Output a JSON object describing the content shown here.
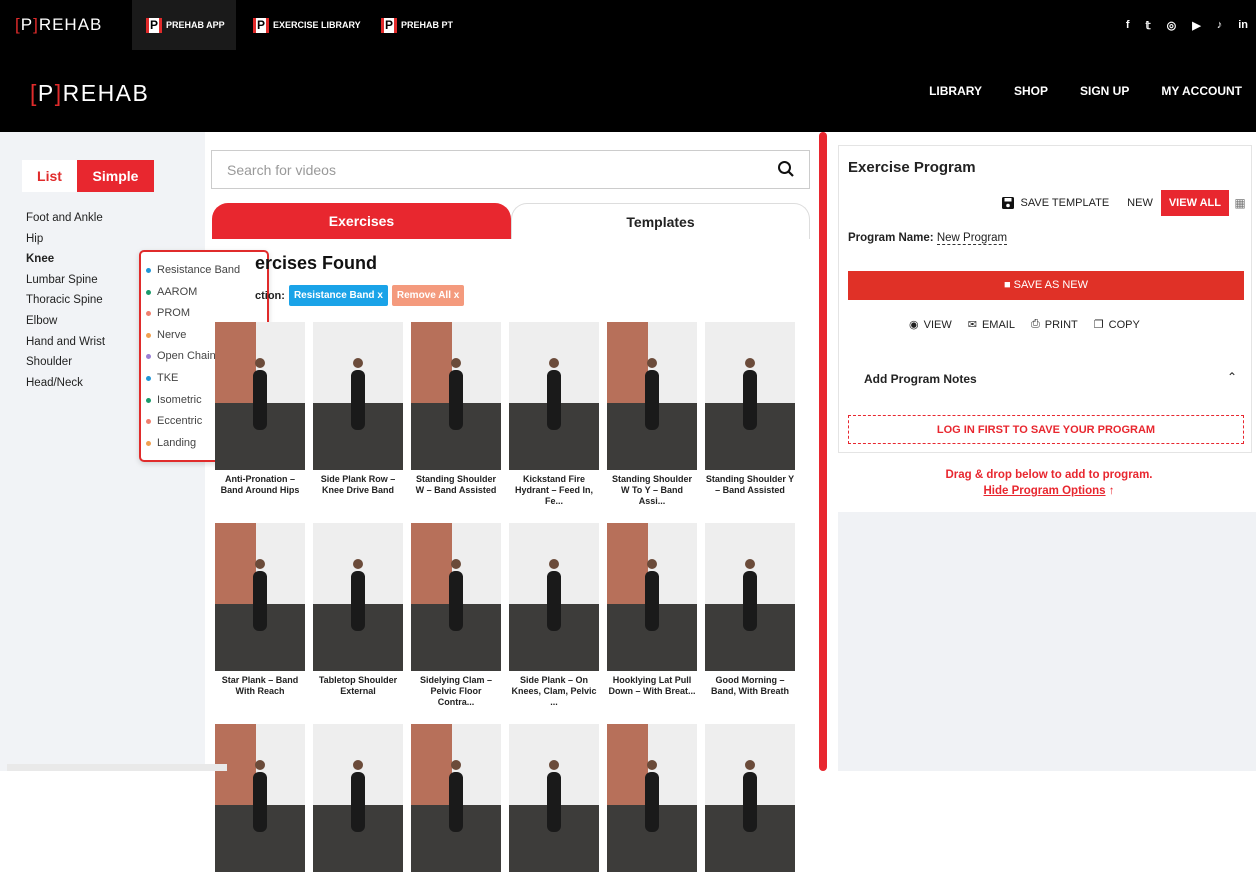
{
  "topbar": {
    "brand": "PREHAB",
    "links": [
      "PREHAB APP",
      "EXERCISE LIBRARY",
      "PREHAB PT"
    ],
    "social_icons": [
      "facebook-icon",
      "twitter-icon",
      "instagram-icon",
      "youtube-icon",
      "tiktok-icon",
      "linkedin-icon"
    ],
    "social_glyphs": [
      "f",
      "𝕥",
      "◎",
      "▶",
      "♪",
      "in"
    ]
  },
  "header": {
    "logo": "PREHAB",
    "nav": [
      "LIBRARY",
      "SHOP",
      "SIGN UP",
      "MY ACCOUNT"
    ]
  },
  "sidebar": {
    "toggle": {
      "list": "List",
      "simple": "Simple"
    },
    "categories": [
      "Foot and Ankle",
      "Hip",
      "Knee",
      "Lumbar Spine",
      "Thoracic Spine",
      "Elbow",
      "Hand and Wrist",
      "Shoulder",
      "Head/Neck"
    ],
    "selected": "Knee"
  },
  "popup": {
    "items": [
      {
        "label": "Resistance Band",
        "color": "#2196d6"
      },
      {
        "label": "AAROM",
        "color": "#1a9a6a"
      },
      {
        "label": "PROM",
        "color": "#f07f6e"
      },
      {
        "label": "Nerve",
        "color": "#f0a050"
      },
      {
        "label": "Open Chain",
        "color": "#9b7fd4"
      },
      {
        "label": "TKE",
        "color": "#2196d6"
      },
      {
        "label": "Isometric",
        "color": "#1a9a6a"
      },
      {
        "label": "Eccentric",
        "color": "#f07f6e"
      },
      {
        "label": "Landing",
        "color": "#f0a050"
      }
    ]
  },
  "search": {
    "placeholder": "Search for videos"
  },
  "tabs": {
    "exercises": "Exercises",
    "templates": "Templates"
  },
  "results": {
    "heading": "ercises Found",
    "selection_label": "ction:",
    "chips": [
      {
        "label": "Resistance Band x",
        "color": "#1aa3e8"
      },
      {
        "label": "Remove All x",
        "color": "#f49a7d"
      }
    ]
  },
  "exercises": [
    "Anti-Pronation – Band Around Hips",
    "Side Plank Row – Knee Drive Band",
    "Standing Shoulder W – Band Assisted",
    "Kickstand Fire Hydrant – Feed In, Fe...",
    "Standing Shoulder W To Y – Band Assi...",
    "Standing Shoulder Y – Band Assisted",
    "Star Plank – Band With Reach",
    "Tabletop Shoulder External",
    "Sidelying Clam – Pelvic Floor Contra...",
    "Side Plank – On Knees, Clam, Pelvic ...",
    "Hooklying Lat Pull Down – With Breat...",
    "Good Morning – Band, With Breath"
  ],
  "program": {
    "title": "Exercise Program",
    "save_template": "SAVE TEMPLATE",
    "new": "NEW",
    "view_all": "VIEW ALL",
    "name_label": "Program Name:",
    "name_value": "New Program",
    "save_as_new": "SAVE AS NEW",
    "actions": [
      "VIEW",
      "EMAIL",
      "PRINT",
      "COPY"
    ],
    "notes": "Add Program Notes",
    "login_warning": "LOG IN FIRST TO SAVE YOUR PROGRAM",
    "drag_hint": "Drag & drop below to add to program.",
    "hide_options": "Hide Program Options",
    "accent": "#e8272f"
  }
}
